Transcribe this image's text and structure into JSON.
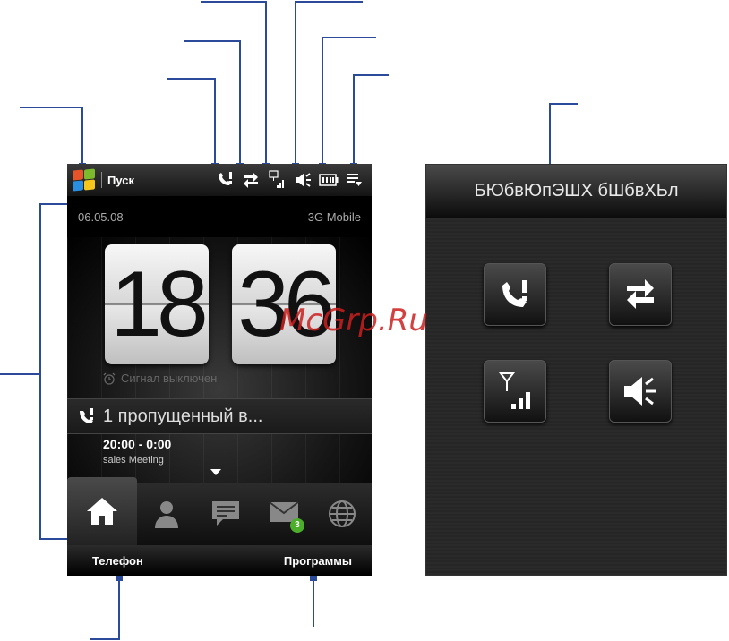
{
  "status_bar": {
    "start_label": "Пуск",
    "icons": [
      "missed-call-icon",
      "data-connection-icon",
      "signal-strength-icon",
      "speaker-icon",
      "battery-icon",
      "menu-icon"
    ]
  },
  "home": {
    "date": "06.05.08",
    "operator": "3G Mobile",
    "clock": {
      "hours": "18",
      "minutes": "36"
    },
    "alarm_text": "Сигнал выключен",
    "missed_calls_text": "1 пропущенный в...",
    "appointment": {
      "time": "20:00 - 0:00",
      "subject": "sales Meeting"
    }
  },
  "tabs": [
    {
      "name": "home",
      "icon": "home-icon",
      "active": true
    },
    {
      "name": "people",
      "icon": "person-icon",
      "active": false
    },
    {
      "name": "messages",
      "icon": "sms-icon",
      "active": false
    },
    {
      "name": "email",
      "icon": "mail-icon",
      "active": false,
      "badge": "3"
    },
    {
      "name": "internet",
      "icon": "globe-icon",
      "active": false
    }
  ],
  "softkeys": {
    "left": "Телефон",
    "right": "Программы"
  },
  "comm_manager": {
    "title": "БЮбвЮпЭШХ бШбвХЬл",
    "buttons": [
      "phone-alert-icon",
      "data-connection-icon",
      "signal-strength-icon",
      "speaker-icon"
    ]
  },
  "watermark": "McGrp.Ru",
  "colors": {
    "callout_line": "#2b4a9a",
    "badge": "#4caf2c",
    "watermark": "#cc1f1f"
  }
}
